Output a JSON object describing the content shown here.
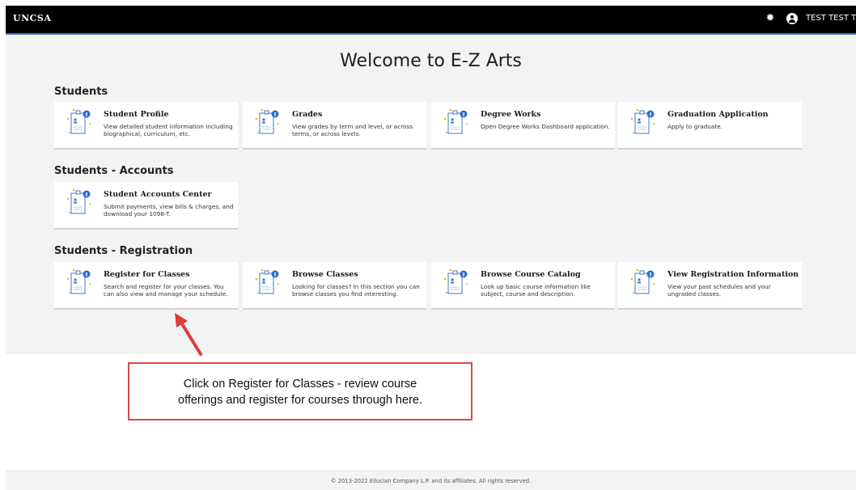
{
  "header": {
    "logo": "UNCSA",
    "username": "TEST TEST TEST",
    "icons": [
      "gear-icon",
      "user-icon"
    ]
  },
  "page_title": "Welcome to E-Z Arts",
  "sections": [
    {
      "heading": "Students",
      "cards": [
        {
          "title": "Student Profile",
          "desc": "View detailed student information including biographical, curriculum, etc."
        },
        {
          "title": "Grades",
          "desc": "View grades by term and level, or across terms, or across levels."
        },
        {
          "title": "Degree Works",
          "desc": "Open Degree Works Dashboard application."
        },
        {
          "title": "Graduation Application",
          "desc": "Apply to graduate."
        }
      ]
    },
    {
      "heading": "Students - Accounts",
      "cards": [
        {
          "title": "Student Accounts Center",
          "desc": "Submit payments, view bills & charges, and download your 1098-T."
        }
      ]
    },
    {
      "heading": "Students - Registration",
      "cards": [
        {
          "title": "Register for Classes",
          "desc": "Search and register for your classes. You can also view and manage your schedule."
        },
        {
          "title": "Browse Classes",
          "desc": "Looking for classes? In this section you can browse classes you find interesting."
        },
        {
          "title": "Browse Course Catalog",
          "desc": "Look up basic course information like subject, course and description."
        },
        {
          "title": "View Registration Information",
          "desc": "View your past schedules and your ungraded classes."
        }
      ]
    }
  ],
  "callout": {
    "line1": "Click on Register for Classes - review course",
    "line2": "offerings and register for courses through here.",
    "color": "#d94a4a"
  },
  "footer": "© 2013-2022 Ellucian Company L.P. and its affiliates. All rights reserved.",
  "colors": {
    "topbar": "#000000",
    "accent": "#3b79c9",
    "background": "#f3f3f3"
  }
}
